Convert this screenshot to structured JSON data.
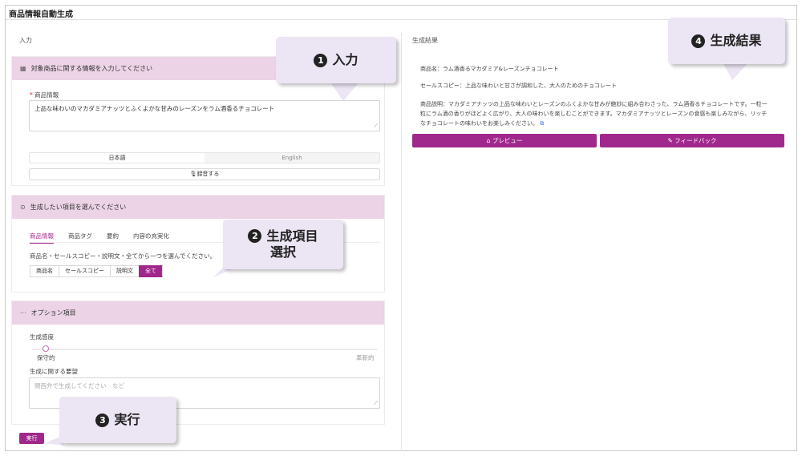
{
  "app": {
    "title": "商品情報自動生成"
  },
  "columns": {
    "input_label": "入力",
    "result_label": "生成結果"
  },
  "panel_input": {
    "header_icon": "list-icon",
    "header": "対象商品に関する情報を入力してください",
    "field_required_mark": "*",
    "field_label": "商品情報",
    "field_value": "上品な味わいのマカダミアナッツとふくよかな甘みのレーズンをラム酒香るチョコレート",
    "languages": [
      "日本語",
      "English"
    ],
    "selected_language": "日本語",
    "record_button": "録音する"
  },
  "panel_items": {
    "header_icon": "help-circle-icon",
    "header": "生成したい項目を選んでください",
    "tabs": [
      "商品情報",
      "商品タグ",
      "要約",
      "内容の充実化"
    ],
    "active_tab": "商品情報",
    "instruction": "商品名・セールスコピー・説明文・全てから一つを選んでください。",
    "options": [
      "商品名",
      "セールスコピー",
      "説明文",
      "全て"
    ],
    "selected_option": "全て"
  },
  "panel_options": {
    "header_icon": "more-horizontal-icon",
    "header": "オプション項目",
    "creativity_label": "生成感度",
    "creativity_level": 0.04,
    "slider_min_label": "保守的",
    "slider_max_label": "革新的",
    "request_label": "生成に関する要望",
    "request_placeholder": "関西弁で生成してください　など"
  },
  "run_button": "実行",
  "result": {
    "product_name": "商品名：ラム酒香るマカダミア&レーズンチョコレート",
    "sales_copy": "セールスコピー：上品な味わいと甘さが調和した、大人のためのチョコレート",
    "description_lines": [
      "商品説明：マカダミアナッツの上品な味わいとレーズンのふくよかな甘みが絶妙に組み合わさった、ラム酒香るチョコレートです。一粒一",
      "粒にラム酒の香りがほどよく広がり、大人の味わいを楽しむことができます。マカダミアナッツとレーズンの食感も楽しみながら、リッチ",
      "なチョコレートの味わいをお楽しみください。"
    ],
    "copy_icon": "copy-icon",
    "preview_button": "プレビュー",
    "feedback_button": "フィードバック"
  },
  "callouts": {
    "c1": {
      "number": "❶",
      "text": "入力"
    },
    "c2": {
      "number": "❷",
      "line1": "生成項目",
      "line2": "選択"
    },
    "c3": {
      "number": "❸",
      "text": "実行"
    },
    "c4": {
      "number": "❹",
      "text": "生成結果"
    }
  },
  "colors": {
    "accent": "#a0288c",
    "panel_header": "#ecd3e6",
    "callout": "#ece5f4"
  }
}
